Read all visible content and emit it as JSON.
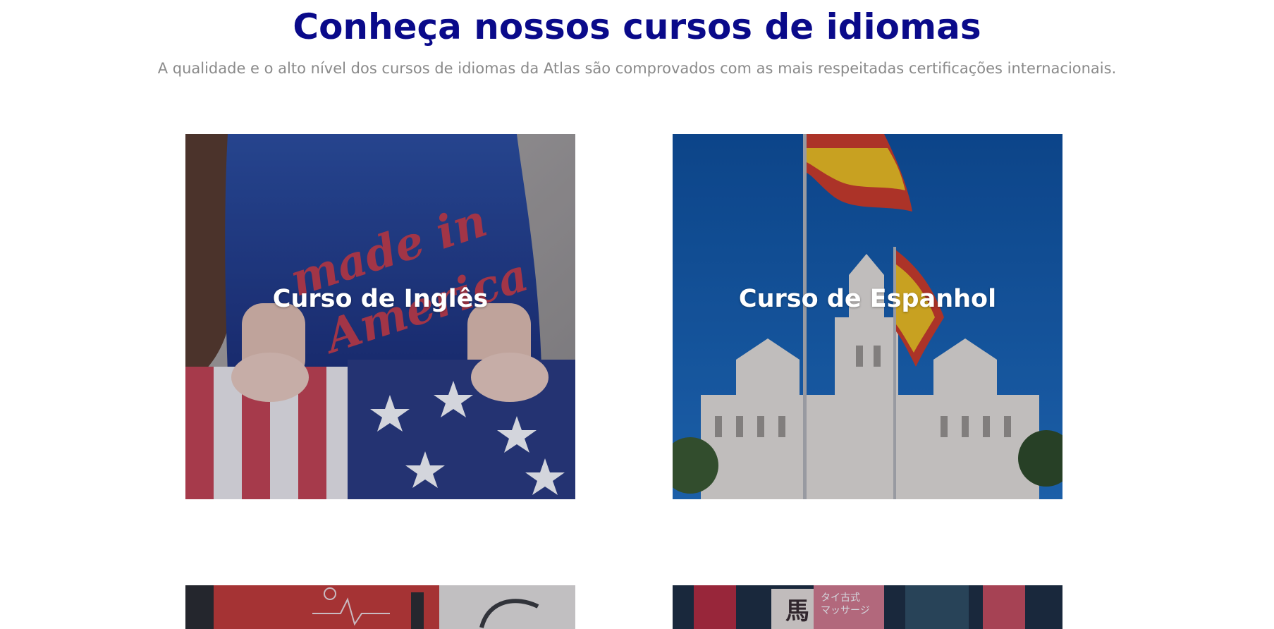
{
  "section": {
    "title": "Conheça nossos cursos de idiomas",
    "subtitle": "A qualidade e o alto nível dos cursos de idiomas da Atlas são comprovados com as mais respeitadas certificações internacionais."
  },
  "courses": [
    {
      "label": "Curso de Inglês",
      "image": "american-flag-shirt-photo"
    },
    {
      "label": "Curso de Espanhol",
      "image": "madrid-palace-spanish-flags-photo"
    },
    {
      "label": "",
      "image": "red-binders-sketch-photo"
    },
    {
      "label": "",
      "image": "tokyo-street-signs-photo"
    }
  ],
  "colors": {
    "title": "#0a0a8a",
    "subtitle": "#8a8a8a",
    "card_text": "#ffffff"
  }
}
